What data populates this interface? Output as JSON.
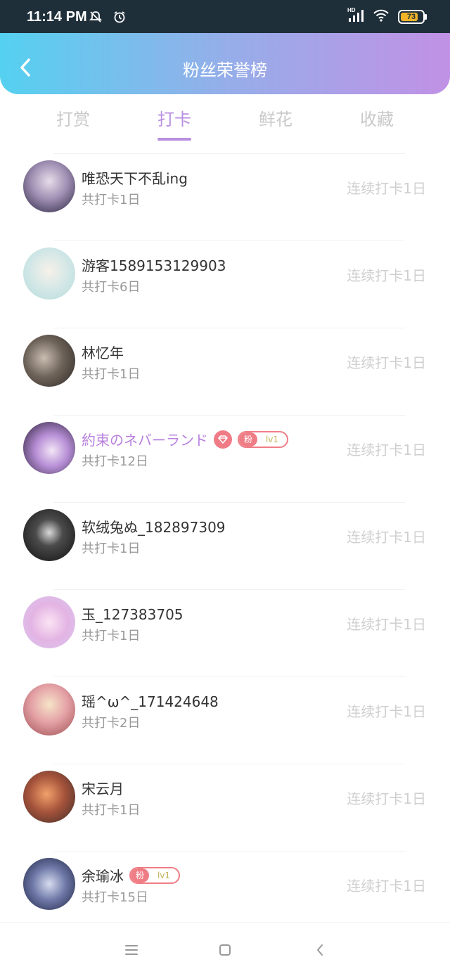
{
  "status": {
    "time": "11:14 PM",
    "network": "HD",
    "battery": "73"
  },
  "header": {
    "title": "粉丝荣誉榜"
  },
  "tabs": [
    {
      "label": "打赏"
    },
    {
      "label": "打卡"
    },
    {
      "label": "鲜花"
    },
    {
      "label": "收藏"
    }
  ],
  "active_tab": "打卡",
  "list": [
    {
      "name": "唯恐天下不乱ing",
      "total": "共打卡1日",
      "streak": "连续打卡1日"
    },
    {
      "name": "游客1589153129903",
      "total": "共打卡6日",
      "streak": "连续打卡1日"
    },
    {
      "name": "林忆年",
      "total": "共打卡1日",
      "streak": "连续打卡1日"
    },
    {
      "name": "約束のネバーランド",
      "total": "共打卡12日",
      "streak": "连续打卡1日",
      "badge_key": "粉",
      "badge_level": "lv1"
    },
    {
      "name": "软绒兔ぬ_182897309",
      "total": "共打卡1日",
      "streak": "连续打卡1日"
    },
    {
      "name": "玉_127383705",
      "total": "共打卡1日",
      "streak": "连续打卡1日"
    },
    {
      "name": "瑶^ω^_171424648",
      "total": "共打卡2日",
      "streak": "连续打卡1日"
    },
    {
      "name": "宋云月",
      "total": "共打卡1日",
      "streak": "连续打卡1日"
    },
    {
      "name": "余瑜冰",
      "total": "共打卡15日",
      "streak": "连续打卡1日",
      "badge_key": "粉",
      "badge_level": "lv1"
    }
  ],
  "colors": {
    "accent": "#b98fe0",
    "badge": "#ef7d86"
  }
}
